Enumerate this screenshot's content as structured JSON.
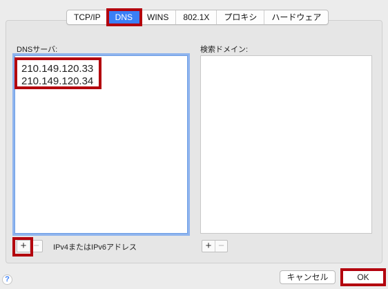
{
  "tabs": [
    {
      "label": "TCP/IP",
      "active": false
    },
    {
      "label": "DNS",
      "active": true
    },
    {
      "label": "WINS",
      "active": false
    },
    {
      "label": "802.1X",
      "active": false
    },
    {
      "label": "プロキシ",
      "active": false
    },
    {
      "label": "ハードウェア",
      "active": false
    }
  ],
  "dns": {
    "label": "DNSサーバ:",
    "servers": [
      "210.149.120.33",
      "210.149.120.34"
    ],
    "add_label": "+",
    "remove_label": "−",
    "hint": "IPv4またはIPv6アドレス"
  },
  "search": {
    "label": "検索ドメイン:",
    "add_label": "+",
    "remove_label": "−"
  },
  "buttons": {
    "help": "?",
    "cancel": "キャンセル",
    "ok": "OK"
  },
  "colors": {
    "accent": "#3b7ff6",
    "highlight": "#b3000d"
  }
}
